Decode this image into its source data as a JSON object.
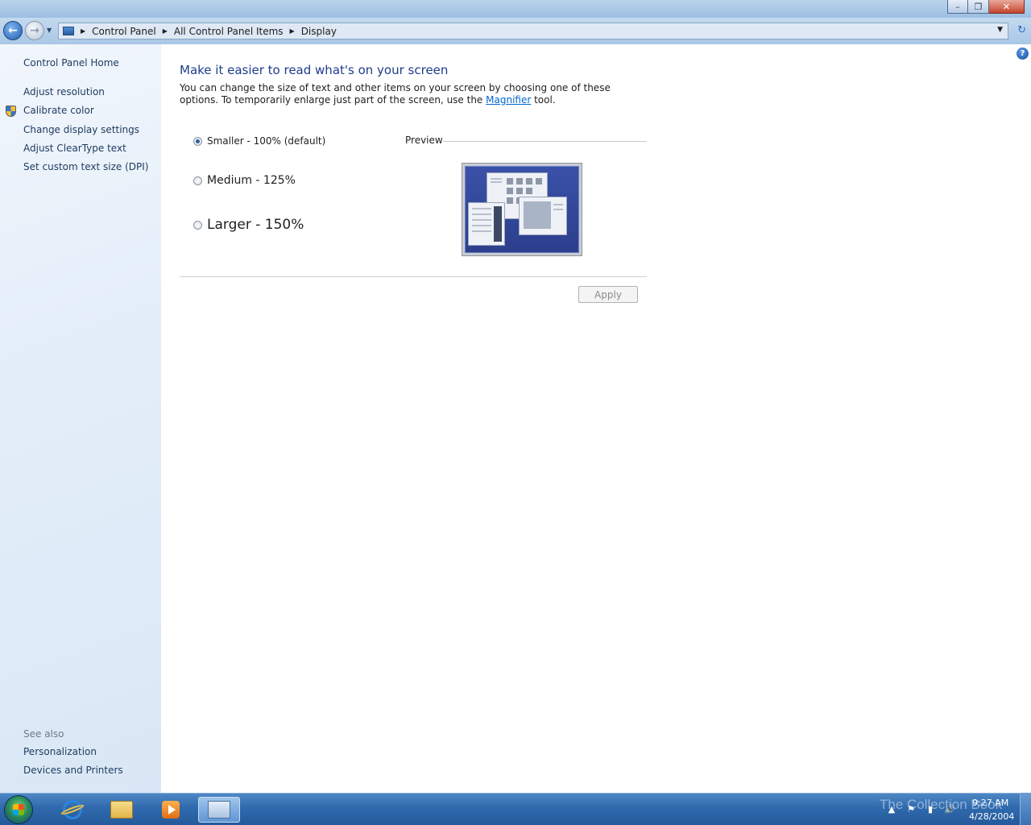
{
  "window": {
    "caption_minimize": "–",
    "caption_restore": "❐",
    "caption_close": "✕"
  },
  "address_bar": {
    "crumbs": [
      "Control Panel",
      "All Control Panel Items",
      "Display"
    ],
    "separator": "▶",
    "dropdown": "▼",
    "refresh": "↻"
  },
  "nav": {
    "back": "←",
    "forward": "→",
    "history": "▼"
  },
  "left_pane": {
    "home": "Control Panel Home",
    "links": [
      "Adjust resolution",
      "Calibrate color",
      "Change display settings",
      "Adjust ClearType text",
      "Set custom text size (DPI)"
    ],
    "see_also_title": "See also",
    "see_also": [
      "Personalization",
      "Devices and Printers"
    ]
  },
  "main": {
    "help": "?",
    "heading": "Make it easier to read what's on your screen",
    "description_before": "You can change the size of text and other items on your screen by choosing one of these options. To temporarily enlarge just part of the screen, use the ",
    "magnifier_link": "Magnifier",
    "description_after": " tool.",
    "options": [
      {
        "label": "Smaller - 100% (default)",
        "checked": true
      },
      {
        "label": "Medium - 125%",
        "checked": false
      },
      {
        "label": "Larger - 150%",
        "checked": false
      }
    ],
    "preview_label": "Preview",
    "apply_label": "Apply"
  },
  "taskbar": {
    "watermark": "The Collection Book",
    "time": "9:27 AM",
    "date": "4/28/2004",
    "tray": [
      "▲",
      "⚑",
      "▮",
      "🔊"
    ]
  },
  "colors": {
    "heading": "#1e3c8c",
    "link": "#0066cc",
    "taskbar": "#2f6aae"
  }
}
